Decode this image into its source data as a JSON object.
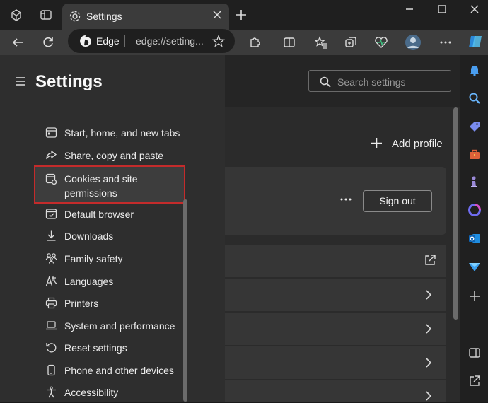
{
  "window": {
    "tab_title": "Settings",
    "controls": [
      "minimize-icon",
      "maximize-icon",
      "close-icon"
    ]
  },
  "addressbar": {
    "site_name": "Edge",
    "url": "edge://setting..."
  },
  "settings": {
    "title": "Settings",
    "search_placeholder": "Search settings",
    "nav_items": [
      {
        "label": "Start, home, and new tabs",
        "icon": "home-tabs-icon"
      },
      {
        "label": "Share, copy and paste",
        "icon": "share-icon"
      },
      {
        "label": "Cookies and site permissions",
        "icon": "cookies-icon",
        "selected": true
      },
      {
        "label": "Default browser",
        "icon": "browser-icon"
      },
      {
        "label": "Downloads",
        "icon": "download-icon"
      },
      {
        "label": "Family safety",
        "icon": "family-icon"
      },
      {
        "label": "Languages",
        "icon": "languages-icon"
      },
      {
        "label": "Printers",
        "icon": "printer-icon"
      },
      {
        "label": "System and performance",
        "icon": "laptop-icon"
      },
      {
        "label": "Reset settings",
        "icon": "reset-icon"
      },
      {
        "label": "Phone and other devices",
        "icon": "phone-icon"
      },
      {
        "label": "Accessibility",
        "icon": "accessibility-icon"
      }
    ]
  },
  "profile": {
    "add_profile_label": "Add profile",
    "sign_out_label": "Sign out",
    "more_label": "..."
  },
  "colors": {
    "highlight_border": "#c42b2b",
    "nav_bg": "#2e2e2e",
    "selected_bg": "#3d3d3d"
  }
}
